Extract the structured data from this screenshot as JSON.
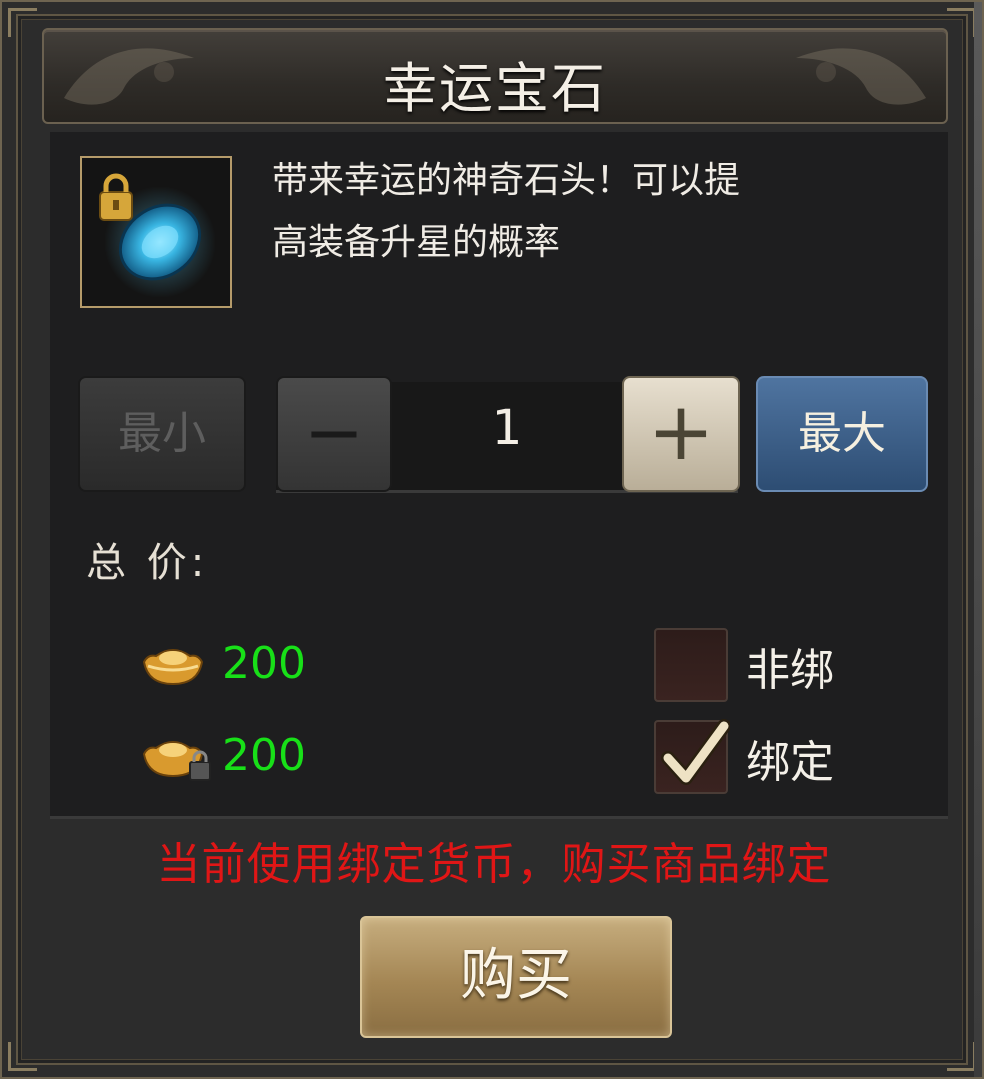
{
  "dialog": {
    "title": "幸运宝石"
  },
  "item": {
    "icon": "blue-gem-icon",
    "locked": true,
    "description_line1": "带来幸运的神奇石头！可以提",
    "description_line2": "高装备升星的概率"
  },
  "quantity": {
    "min_label": "最小",
    "minus_symbol": "−",
    "value": "1",
    "plus_symbol": "+",
    "max_label": "最大"
  },
  "price": {
    "label": "总 价:",
    "rows": [
      {
        "icon": "gold-ingot-icon",
        "amount": "200"
      },
      {
        "icon": "bound-gold-ingot-icon",
        "amount": "200"
      }
    ]
  },
  "binding": {
    "options": [
      {
        "label": "非绑",
        "checked": false
      },
      {
        "label": "绑定",
        "checked": true
      }
    ]
  },
  "notice": "当前使用绑定货币，购买商品绑定",
  "buy_label": "购买",
  "colors": {
    "price_green": "#18e018",
    "notice_red": "#e01616",
    "max_button_blue": "#3d5f88",
    "buy_button_gold": "#a48654"
  }
}
